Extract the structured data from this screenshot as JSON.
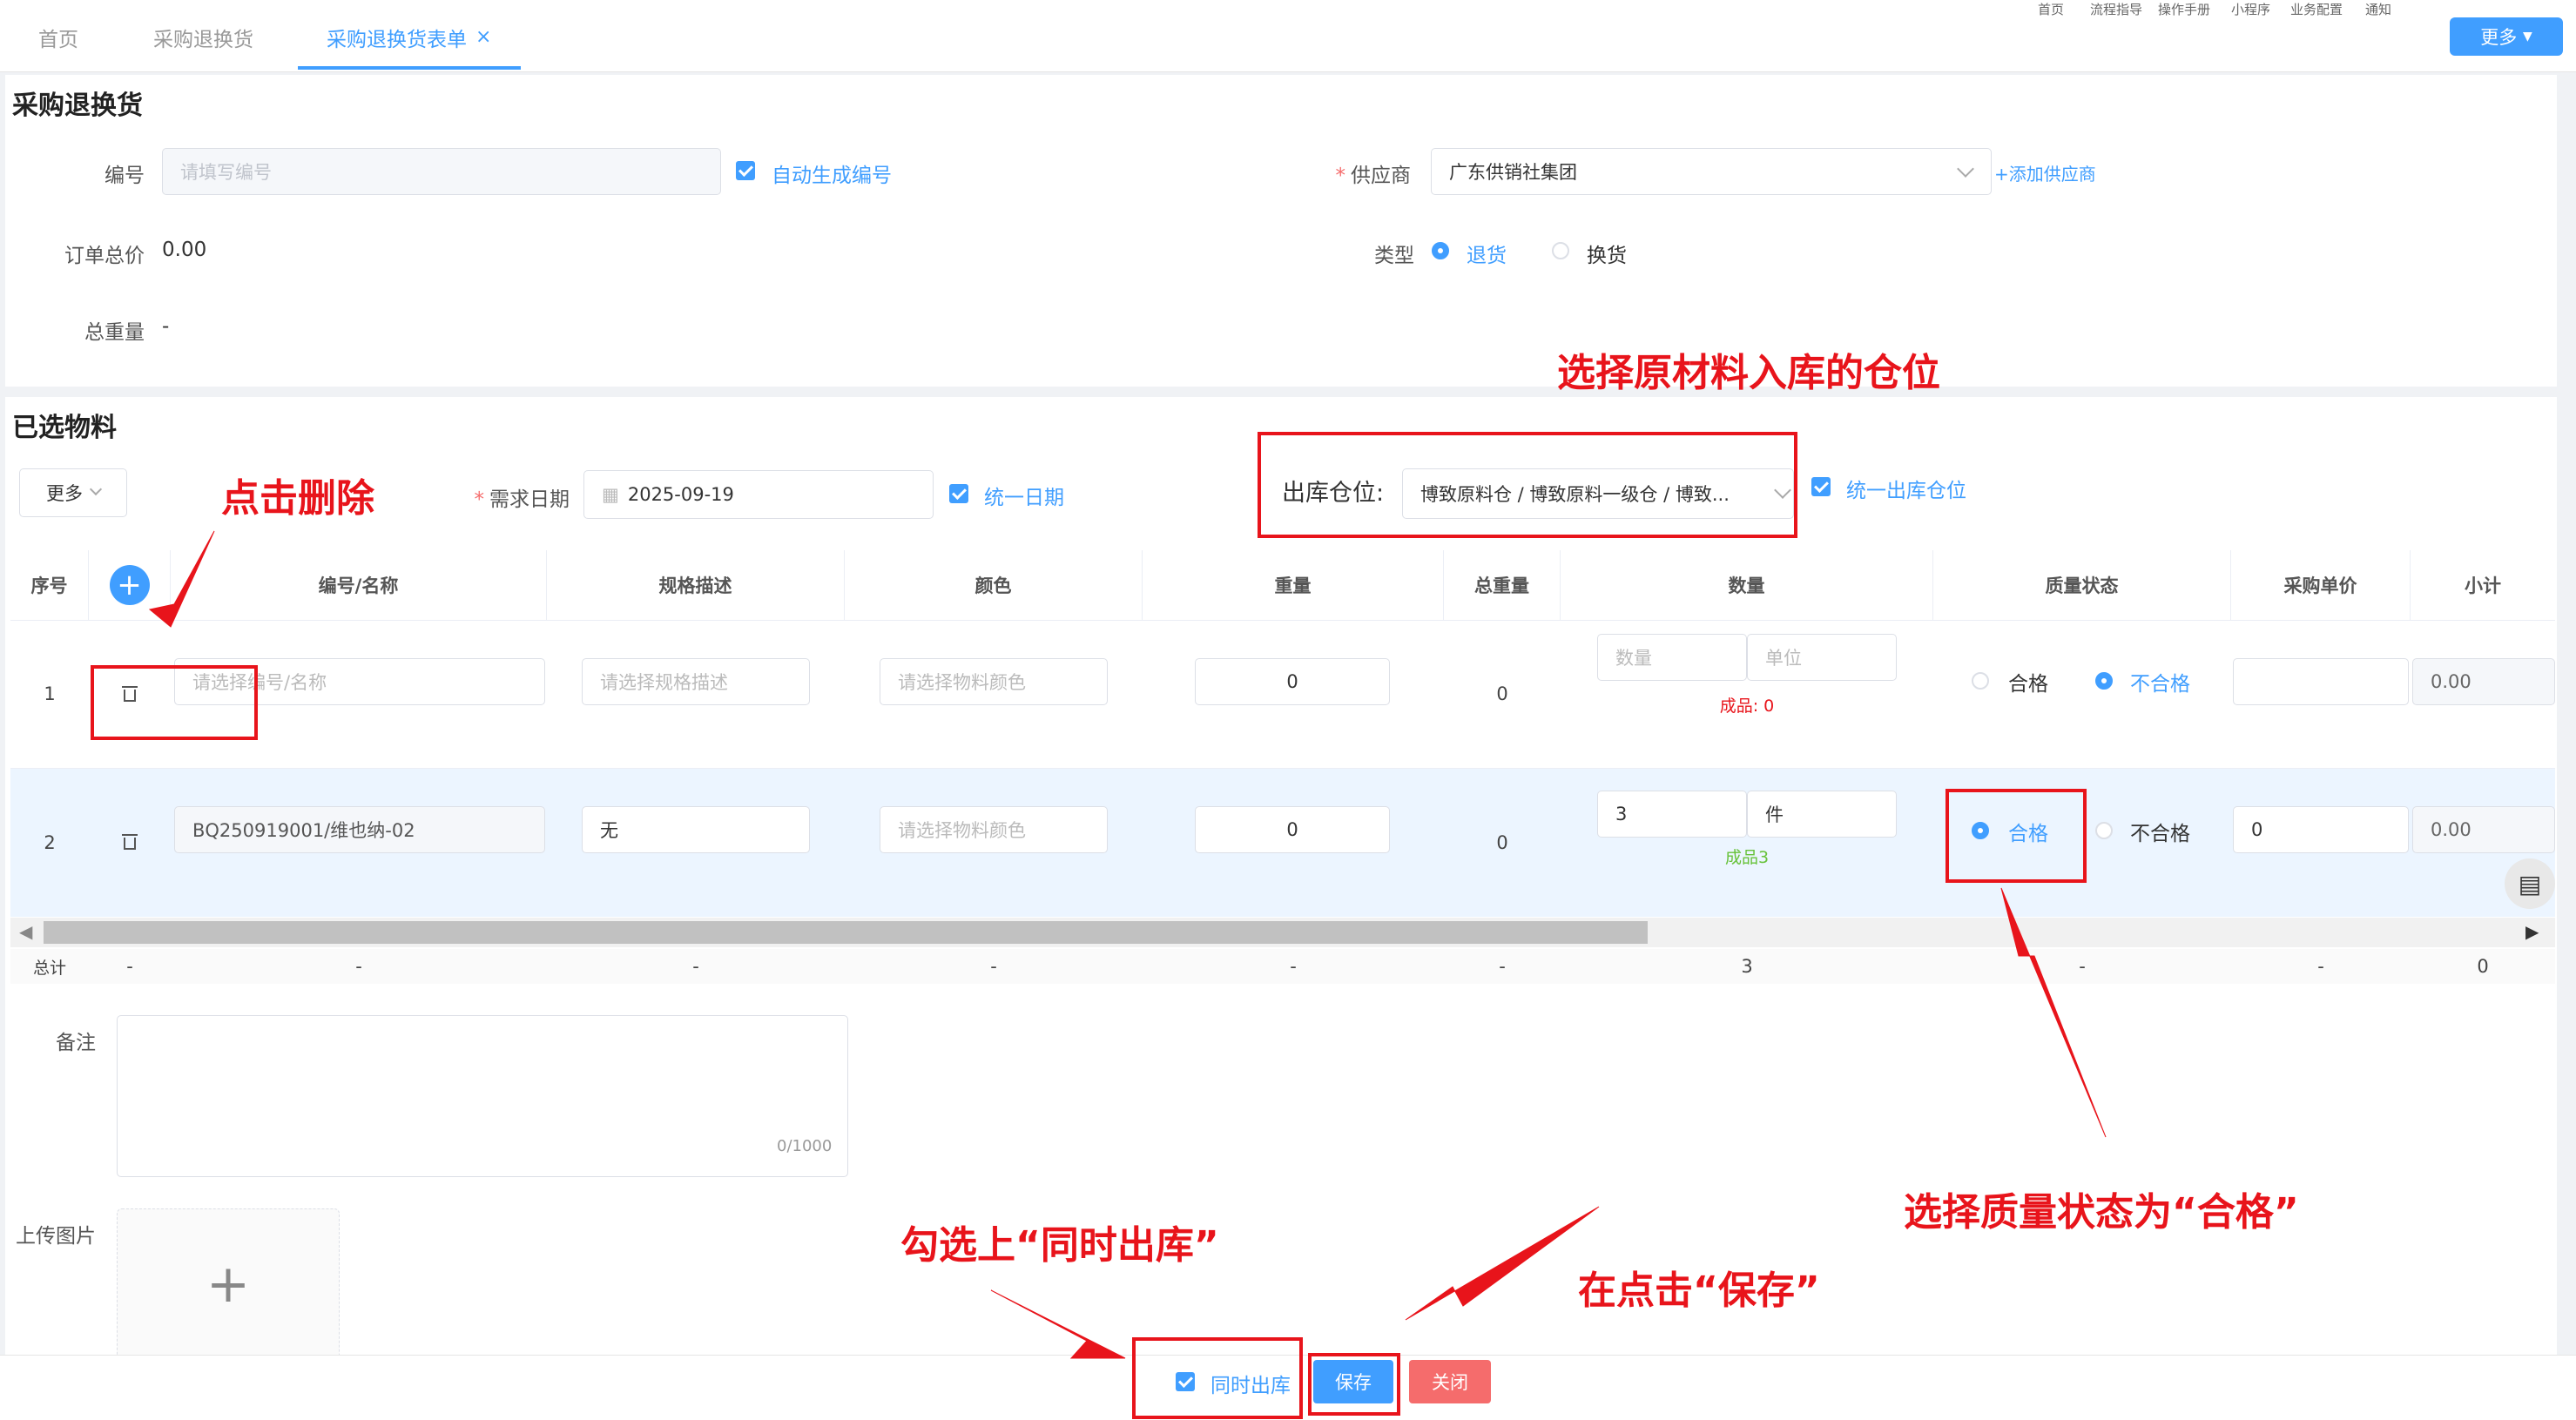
{
  "tabs": {
    "home": "首页",
    "list": "采购退换货",
    "form": "采购退换货表单",
    "close": "×"
  },
  "top_links": [
    "首页",
    "流程指导",
    "操作手册",
    "小程序",
    "业务配置",
    "通知"
  ],
  "more_button": "更多",
  "header": {
    "title": "采购退换货",
    "code_label": "编号",
    "code_placeholder": "请填写编号",
    "auto_code": "自动生成编号",
    "supplier_label": "供应商",
    "supplier_value": "广东供销社集团",
    "add_supplier": "+添加供应商",
    "total_price_label": "订单总价",
    "total_price_value": "0.00",
    "type_label": "类型",
    "type_return": "退货",
    "type_exchange": "换货",
    "total_weight_label": "总重量",
    "total_weight_value": "-"
  },
  "materials": {
    "title": "已选物料",
    "more": "更多",
    "date_label": "需求日期",
    "date_value": "2025-09-19",
    "unify_date": "统一日期",
    "warehouse_label": "出库仓位:",
    "warehouse_value": "博致原料仓 / 博致原料一级仓 / 博致...",
    "unify_warehouse": "统一出库仓位"
  },
  "table": {
    "headers": [
      "序号",
      "编号/名称",
      "规格描述",
      "颜色",
      "重量",
      "总重量",
      "数量",
      "质量状态",
      "采购单价",
      "小计"
    ],
    "rows": [
      {
        "index": "1",
        "name_placeholder": "请选择编号/名称",
        "spec_placeholder": "请选择规格描述",
        "color_placeholder": "请选择物料颜色",
        "weight": "0",
        "total_weight": "0",
        "qty_placeholder": "数量",
        "unit_placeholder": "单位",
        "stock": "成品: 0",
        "q_ok": "合格",
        "q_bad": "不合格",
        "price": "",
        "subtotal": "0.00"
      },
      {
        "index": "2",
        "name": "BQ250919001/维也纳-02",
        "spec": "无",
        "color_placeholder": "请选择物料颜色",
        "weight": "0",
        "total_weight": "0",
        "qty": "3",
        "unit": "件",
        "stock": "成品3",
        "q_ok": "合格",
        "q_bad": "不合格",
        "price": "0",
        "subtotal": "0.00"
      }
    ],
    "totals": {
      "label": "总计",
      "dash": "-",
      "qty": "3",
      "subtotal": "0"
    }
  },
  "remark": {
    "label": "备注",
    "counter": "0/1000"
  },
  "upload": {
    "label": "上传图片"
  },
  "footer": {
    "outbound": "同时出库",
    "save": "保存",
    "close": "关闭"
  },
  "annotations": {
    "warehouse": "选择原材料入库的仓位",
    "delete": "点击删除",
    "quality": "选择质量状态为“合格”",
    "outbound": "勾选上“同时出库”",
    "save": "在点击“保存”"
  },
  "colors": {
    "accent": "#409eff",
    "annotation": "#e8141b",
    "danger": "#f56c6c"
  }
}
